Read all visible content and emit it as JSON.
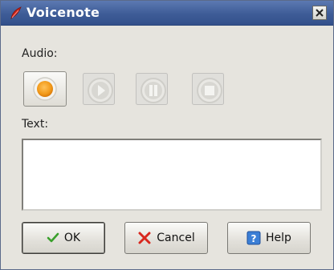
{
  "window": {
    "title": "Voicenote",
    "app_icon": "red-feather-icon",
    "close_icon": "close-icon"
  },
  "audio": {
    "label": "Audio:",
    "controls": [
      {
        "name": "record",
        "icon": "record-icon",
        "enabled": true
      },
      {
        "name": "play",
        "icon": "play-icon",
        "enabled": false
      },
      {
        "name": "pause",
        "icon": "pause-icon",
        "enabled": false
      },
      {
        "name": "stop",
        "icon": "stop-icon",
        "enabled": false
      }
    ]
  },
  "text": {
    "label": "Text:",
    "value": ""
  },
  "buttons": {
    "ok_label": "OK",
    "cancel_label": "Cancel",
    "help_label": "Help"
  },
  "colors": {
    "titlebar": "#3e5c97",
    "record_accent": "#f29a1a",
    "ok_check": "#3aa02c",
    "cancel_x": "#d8281e",
    "help_icon": "#3b7fd6"
  }
}
